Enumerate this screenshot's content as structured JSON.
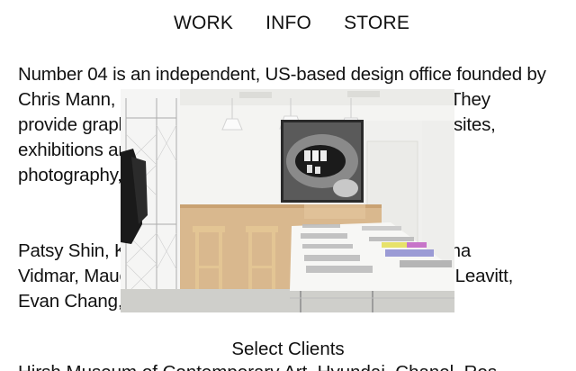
{
  "nav": {
    "items": [
      {
        "label": "WORK"
      },
      {
        "label": "INFO"
      },
      {
        "label": "STORE"
      }
    ]
  },
  "about": {
    "lines": [
      "Number 04 is an independent, US-based design office founded by",
      "Chris Mann, C                                                            e. They",
      "provide graph                                                           websites,",
      "exhibitions ar                                                          n for",
      "photography,"
    ]
  },
  "team": {
    "lines": [
      "Patsy Shin, K                                                           Emma",
      "Vidmar, Mauc                                                            ate Leavitt,",
      "Evan Chang,"
    ]
  },
  "clients": {
    "heading": "Select Clients",
    "partial_line": "Hirsh Museum of Contemporary Art, Hyundai, Chanel, Ros"
  },
  "photo": {
    "subject": "studio-interior-with-tables-and-stools",
    "colors": {
      "wall": "#f4f4f2",
      "wood": "#d7b58c",
      "table": "#f7f7f5",
      "rack": "#d8d8d8"
    }
  }
}
